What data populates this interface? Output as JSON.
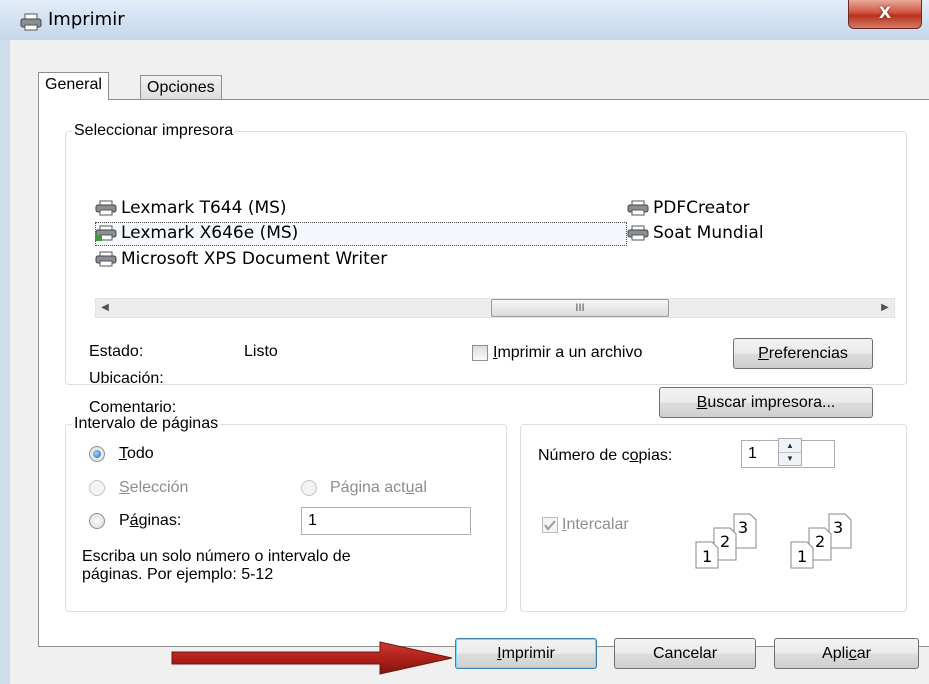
{
  "window": {
    "title": "Imprimir",
    "close_label": "X"
  },
  "tabs": [
    {
      "label": "General"
    },
    {
      "label": "Opciones"
    }
  ],
  "select_printer": {
    "legend": "Seleccionar impresora",
    "printers": [
      {
        "name": "Lexmark T644 (MS)"
      },
      {
        "name": "Lexmark X646e (MS)"
      },
      {
        "name": "Microsoft XPS Document Writer"
      },
      {
        "name": "PDFCreator"
      },
      {
        "name": "Soat Mundial"
      }
    ],
    "selected": "Lexmark X646e (MS)",
    "scroll_thumb_label": "III",
    "status_label": "Estado:",
    "status_value": "Listo",
    "location_label": "Ubicación:",
    "comment_label": "Comentario:",
    "print_to_file": {
      "pre": "",
      "accel": "I",
      "post": "mprimir a un archivo"
    },
    "preferences": {
      "pre": "",
      "accel": "P",
      "post": "referencias"
    },
    "find_printer": {
      "pre": "",
      "accel": "B",
      "post": "uscar impresora..."
    }
  },
  "page_range": {
    "legend": "Intervalo de páginas",
    "all": {
      "pre": "",
      "accel": "T",
      "post": "odo"
    },
    "selection": {
      "pre": "",
      "accel": "S",
      "post": "elección"
    },
    "current_page": {
      "pre": "Página act",
      "accel": "u",
      "post": "al"
    },
    "pages": {
      "pre": "P",
      "accel": "á",
      "post": "ginas:"
    },
    "pages_value": "1",
    "hint_line1": "Escriba un solo número o intervalo de",
    "hint_line2": "páginas. Por ejemplo: 5-12"
  },
  "copies": {
    "label": {
      "pre": "Número de c",
      "accel": "o",
      "post": "pias:"
    },
    "value": "1",
    "collate": {
      "pre": "",
      "accel": "I",
      "post": "ntercalar"
    },
    "collate_checked": true,
    "page_numbers": [
      "1",
      "2",
      "3"
    ]
  },
  "buttons": {
    "print": {
      "pre": "",
      "accel": "I",
      "post": "mprimir"
    },
    "cancel": {
      "label": "Cancelar"
    },
    "apply": {
      "pre": "Apli",
      "accel": "c",
      "post": "ar"
    }
  },
  "colors": {
    "annotation_arrow": "#b0211c",
    "selection_border": "#3c7fb1"
  }
}
